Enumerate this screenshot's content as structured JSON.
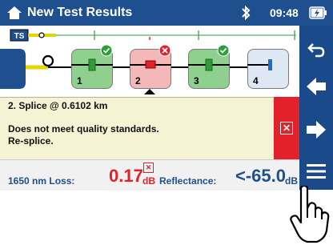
{
  "titlebar": {
    "title": "New Test Results",
    "time": "09:48"
  },
  "trace": {
    "ts_label": "TS",
    "events": [
      {
        "num": "1",
        "status": "pass"
      },
      {
        "num": "2",
        "status": "fail"
      },
      {
        "num": "3",
        "status": "pass"
      },
      {
        "num": "4",
        "status": "none"
      }
    ]
  },
  "detail": {
    "line1": "2. Splice @ 0.6102 km",
    "line2": "Does not meet quality standards.",
    "line3": "Re-splice."
  },
  "bottom": {
    "loss_label": "1650 nm Loss:",
    "loss_value": "0.17",
    "loss_unit": "dB",
    "refl_label": "Reflectance:",
    "refl_value": "<-65.0",
    "refl_unit": "dB"
  },
  "colors": {
    "header_blue": "#1e4f8e",
    "fail_red": "#e3212b",
    "pass_green": "#2e9e3c",
    "detail_bg": "#f6f3d4"
  }
}
